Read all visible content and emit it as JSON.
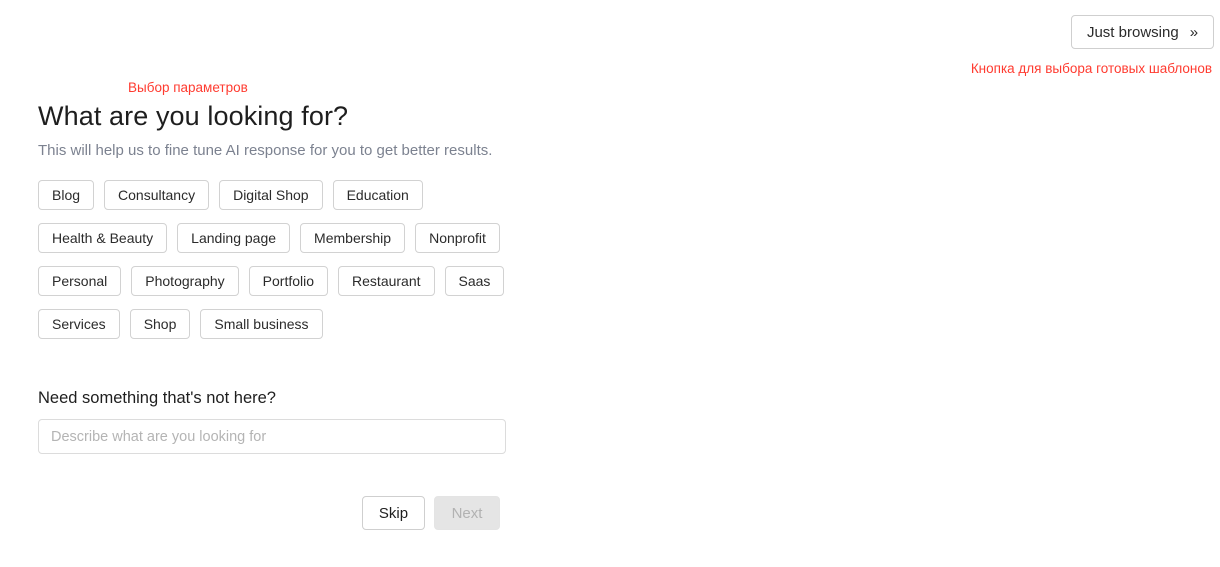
{
  "header": {
    "browse_button_label": "Just browsing",
    "browse_button_icon": "double-chevron-right-icon"
  },
  "annotations": {
    "right": "Кнопка для выбора готовых шаблонов",
    "left": "Выбор параметров"
  },
  "main": {
    "title": "What are you looking for?",
    "subtitle": "This will help us to fine tune AI response for you to get better results.",
    "tag_rows": [
      [
        "Blog",
        "Consultancy",
        "Digital Shop",
        "Education"
      ],
      [
        "Health & Beauty",
        "Landing page",
        "Membership",
        "Nonprofit"
      ],
      [
        "Personal",
        "Photography",
        "Portfolio",
        "Restaurant",
        "Saas"
      ],
      [
        "Services",
        "Shop",
        "Small business"
      ]
    ],
    "need_label": "Need something that's not here?",
    "describe_placeholder": "Describe what are you looking for",
    "describe_value": ""
  },
  "actions": {
    "skip_label": "Skip",
    "next_label": "Next"
  },
  "colors": {
    "annotation": "#ff3b30",
    "title": "#1e1e1e",
    "subtitle": "#7c8290",
    "border": "#d2d2d2",
    "next_disabled_bg": "#e5e5e5",
    "next_disabled_text": "#b2b2b2"
  }
}
